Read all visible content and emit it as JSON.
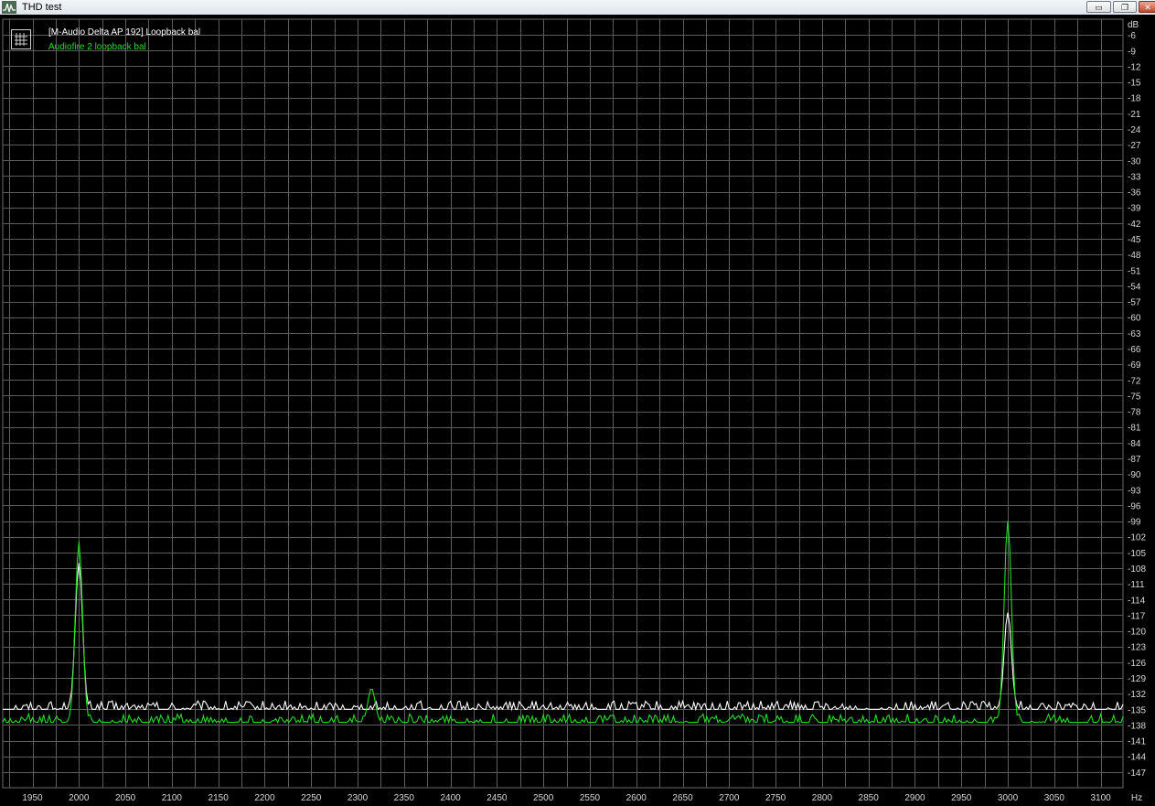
{
  "window": {
    "title": "THD test",
    "minimize": "▭",
    "maximize": "❐",
    "close": "✕"
  },
  "legend": {
    "icon": "grid-icon"
  },
  "chart_data": {
    "type": "line",
    "xunit": "Hz",
    "yunit": "dB",
    "xlim": [
      1918,
      3124
    ],
    "ylim": [
      -150,
      -3
    ],
    "xticks": [
      1950,
      2000,
      2050,
      2100,
      2150,
      2200,
      2250,
      2300,
      2350,
      2400,
      2450,
      2500,
      2550,
      2600,
      2650,
      2700,
      2750,
      2800,
      2850,
      2900,
      2950,
      3000,
      3050,
      3100
    ],
    "yticks": [
      -6,
      -9,
      -12,
      -15,
      -18,
      -21,
      -24,
      -27,
      -30,
      -33,
      -36,
      -39,
      -42,
      -45,
      -48,
      -51,
      -54,
      -57,
      -60,
      -63,
      -66,
      -69,
      -72,
      -75,
      -78,
      -81,
      -84,
      -87,
      -90,
      -93,
      -96,
      -99,
      -102,
      -105,
      -108,
      -111,
      -114,
      -117,
      -120,
      -123,
      -126,
      -129,
      -132,
      -135,
      -138,
      -141,
      -144,
      -147
    ],
    "grid": true,
    "legend_position": "top-left",
    "series": [
      {
        "name": "[M-Audio Delta AP 192] Loopback bal",
        "color": "#ffffff",
        "noise_floor": -135,
        "peaks": [
          {
            "x": 2000,
            "y": -107
          },
          {
            "x": 3000,
            "y": -116.5
          }
        ]
      },
      {
        "name": "Audiofire 2 loopback bal",
        "color": "#22dd22",
        "noise_floor": -137.5,
        "peaks": [
          {
            "x": 2000,
            "y": -103
          },
          {
            "x": 2315,
            "y": -131
          },
          {
            "x": 3000,
            "y": -99
          }
        ]
      }
    ]
  }
}
